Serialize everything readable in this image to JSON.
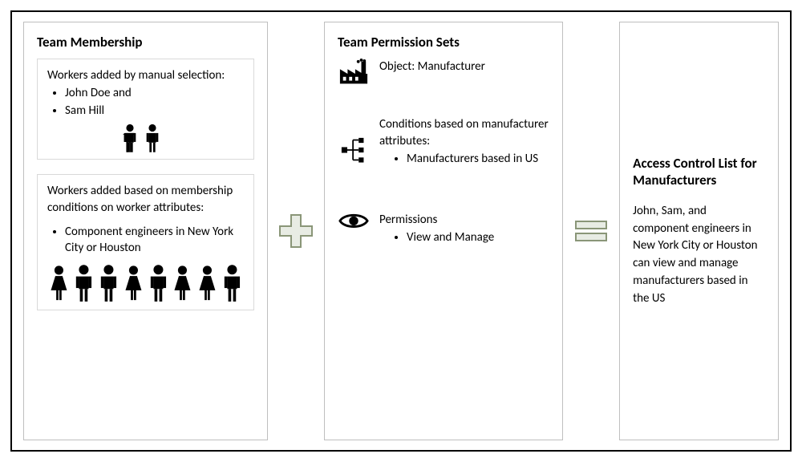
{
  "left": {
    "title": "Team Membership",
    "manual": {
      "intro": "Workers added by manual selection:",
      "items": [
        "John Doe and",
        "Sam Hill"
      ]
    },
    "cond": {
      "intro": "Workers added based on membership  conditions on worker attributes:",
      "items": [
        "Component engineers in New York City or Houston"
      ]
    }
  },
  "mid": {
    "title": "Team Permission Sets",
    "object_label": "Object: Manufacturer",
    "cond_intro": "Conditions based on manufacturer attributes:",
    "cond_items": [
      "Manufacturers based in US"
    ],
    "perm_label": "Permissions",
    "perm_items": [
      "View and Manage"
    ]
  },
  "right": {
    "title": "Access Control List for Manufacturers",
    "body": "John, Sam, and component engineers in New York City or Houston can view and manage manufacturers based in the US"
  }
}
